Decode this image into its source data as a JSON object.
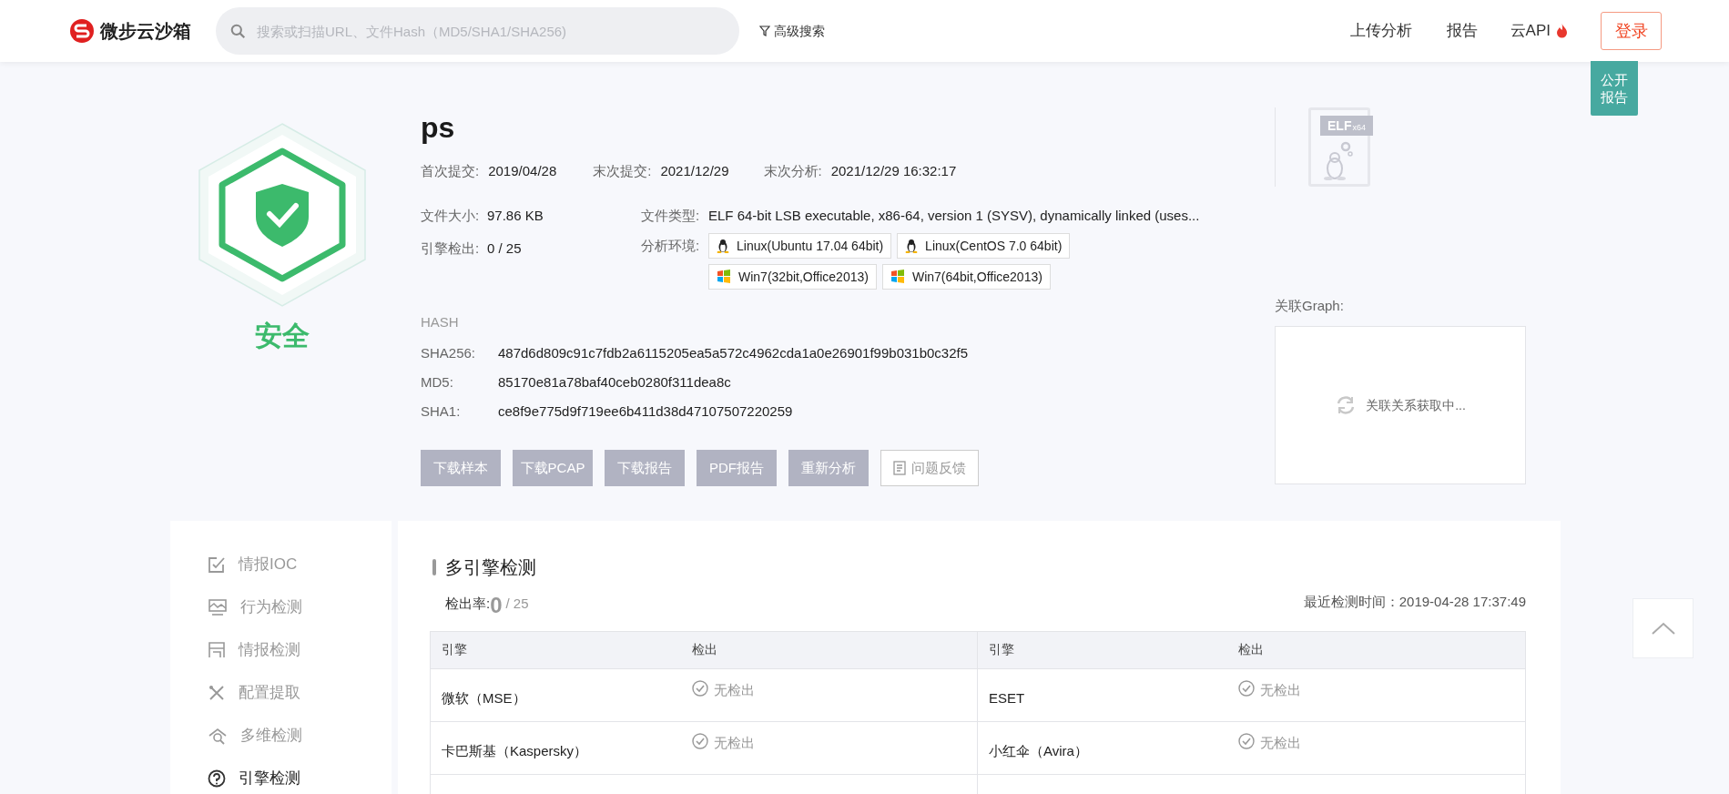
{
  "header": {
    "logo_text": "微步云沙箱",
    "search": {
      "placeholder": "搜索或扫描URL、文件Hash（MD5/SHA1/SHA256)"
    },
    "advanced_search": "高级搜索",
    "nav": [
      {
        "label": "上传分析",
        "hot": false
      },
      {
        "label": "报告",
        "hot": false
      },
      {
        "label": "云API",
        "hot": true
      }
    ],
    "login_button": "登录"
  },
  "public_report_button": "公开报告",
  "verdict": "安全",
  "file": {
    "name": "ps",
    "dates": [
      {
        "label": "首次提交:",
        "value": "2019/04/28"
      },
      {
        "label": "末次提交:",
        "value": "2021/12/29"
      },
      {
        "label": "末次分析:",
        "value": "2021/12/29 16:32:17"
      }
    ],
    "size": {
      "label": "文件大小:",
      "value": "97.86 KB"
    },
    "engine_hits": {
      "label": "引擎检出:",
      "value": "0 / 25"
    },
    "type": {
      "label": "文件类型:",
      "value": "ELF 64-bit LSB executable, x86-64, version 1 (SYSV), dynamically linked (uses..."
    },
    "environments": {
      "label": "分析环境:",
      "items": [
        {
          "kind": "linux",
          "label": "Linux(Ubuntu 17.04 64bit)"
        },
        {
          "kind": "linux",
          "label": "Linux(CentOS 7.0 64bit)"
        },
        {
          "kind": "windows",
          "label": "Win7(32bit,Office2013)"
        },
        {
          "kind": "windows",
          "label": "Win7(64bit,Office2013)"
        }
      ]
    },
    "hash_title": "HASH",
    "hashes": [
      {
        "label": "SHA256:",
        "value": "487d6d809c91c7fdb2a6115205ea5a572c4962cda1a0e26901f99b031b0c32f5"
      },
      {
        "label": "MD5:",
        "value": "85170e81a78baf40ceb0280f311dea8c"
      },
      {
        "label": "SHA1:",
        "value": "ce8f9e775d9f719ee6b411d38d47107507220259"
      }
    ],
    "actions": [
      {
        "label": "下载样本",
        "kind": "solid"
      },
      {
        "label": "下载PCAP",
        "kind": "solid"
      },
      {
        "label": "下载报告",
        "kind": "solid"
      },
      {
        "label": "PDF报告",
        "kind": "solid"
      },
      {
        "label": "重新分析",
        "kind": "solid"
      },
      {
        "label": "问题反馈",
        "kind": "outline"
      }
    ]
  },
  "file_type_badge": {
    "label": "ELF",
    "sub": "x64"
  },
  "graph": {
    "title": "关联Graph:",
    "loading": "关联关系获取中..."
  },
  "sidebar": {
    "items": [
      {
        "label": "情报IOC",
        "selected": false
      },
      {
        "label": "行为检测",
        "selected": false
      },
      {
        "label": "情报检测",
        "selected": false
      },
      {
        "label": "配置提取",
        "selected": false
      },
      {
        "label": "多维检测",
        "selected": false
      },
      {
        "label": "引擎检测",
        "selected": true
      }
    ]
  },
  "engines_section": {
    "title": "多引擎检测",
    "rate_label": "检出率:",
    "rate_value": "0",
    "rate_total": "/ 25",
    "last_time": "最近检测时间：2019-04-28 17:37:49",
    "columns": [
      "引擎",
      "检出",
      "引擎",
      "检出"
    ],
    "rows": [
      [
        "微软（MSE）",
        "无检出",
        "ESET",
        "无检出"
      ],
      [
        "卡巴斯基（Kaspersky）",
        "无检出",
        "小红伞（Avira）",
        "无检出"
      ]
    ]
  }
}
